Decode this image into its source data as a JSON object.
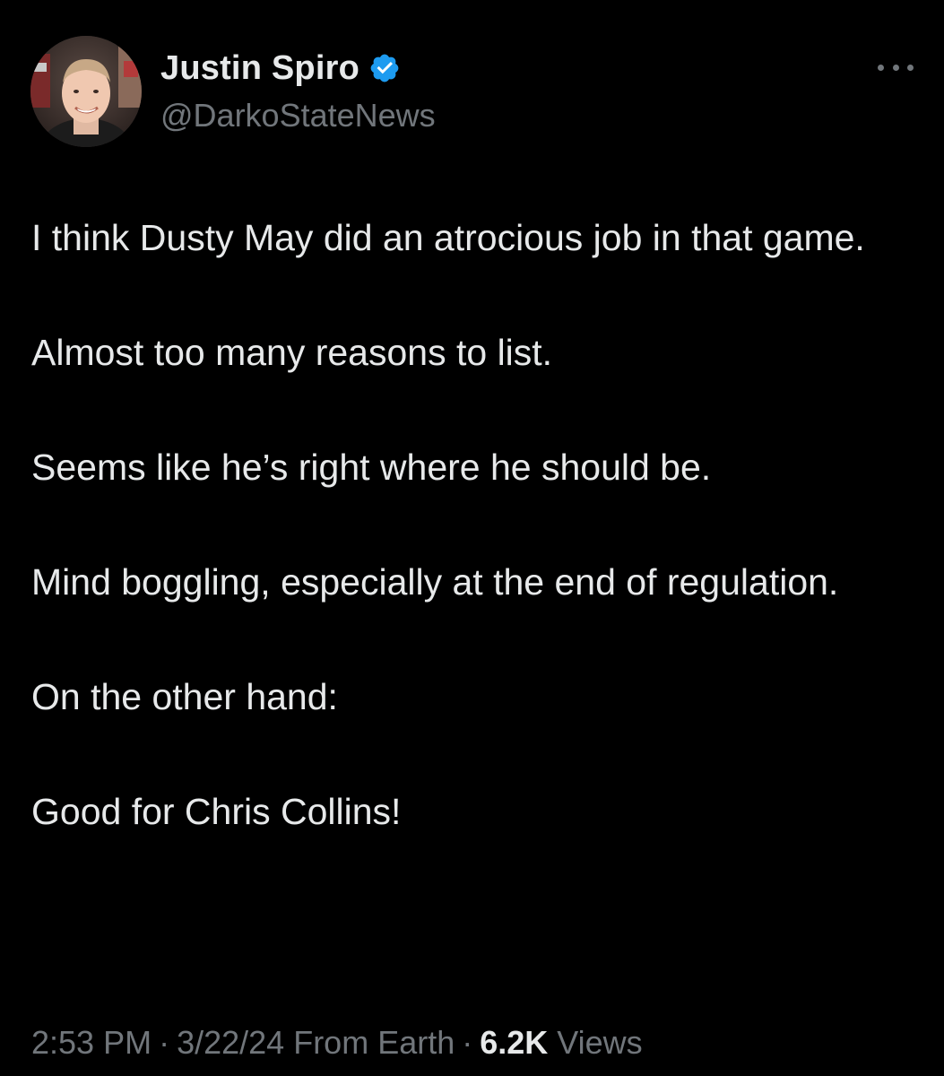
{
  "author": {
    "display_name": "Justin Spiro",
    "handle": "@DarkoStateNews",
    "verified": true,
    "verified_color": "#1d9bf0",
    "avatar_icon": "avatar-photo"
  },
  "more_icon": "ellipsis-icon",
  "tweet": {
    "paragraphs": [
      "I think Dusty May did an atrocious job in that game.",
      "Almost too many reasons to list.",
      "Seems like he’s right where he should be.",
      "Mind boggling, especially at the end of regulation.",
      "On the other hand:",
      "Good for Chris Collins!"
    ]
  },
  "meta": {
    "time": "2:53 PM",
    "separator": "·",
    "date": "3/22/24",
    "source": "From Earth",
    "views_count": "6.2K",
    "views_label": "Views"
  },
  "colors": {
    "background": "#000000",
    "primary_text": "#e7e9ea",
    "secondary_text": "#71767b"
  }
}
